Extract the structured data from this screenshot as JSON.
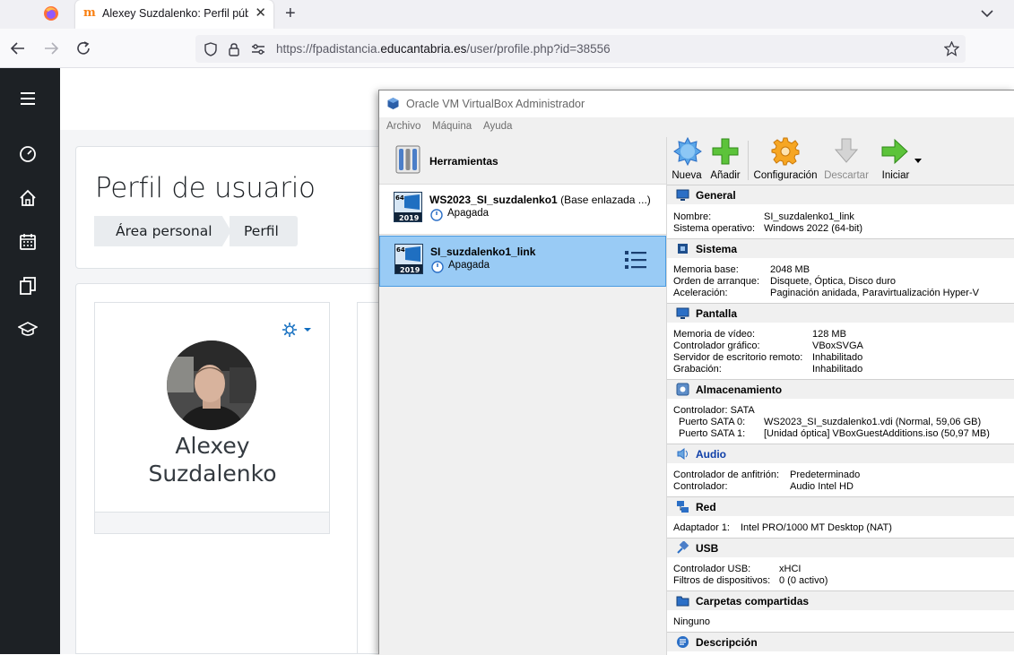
{
  "browser": {
    "tab_title": "Alexey Suzdalenko: Perfil público",
    "url_prefix": "https://fpadistancia.",
    "url_domain": "educantabria.es",
    "url_suffix": "/user/profile.php?id=38556"
  },
  "moodle": {
    "page_title": "Perfil de usuario",
    "breadcrumb": [
      "Área personal",
      "Perfil"
    ],
    "user_first": "Alexey",
    "user_last": "Suzdalenko",
    "sidebar_icons": [
      "menu-icon",
      "dashboard-icon",
      "home-icon",
      "calendar-icon",
      "files-icon",
      "courses-icon"
    ]
  },
  "vbox": {
    "title": "Oracle VM VirtualBox Administrador",
    "menu": [
      "Archivo",
      "Máquina",
      "Ayuda"
    ],
    "tools_label": "Herramientas",
    "vms": [
      {
        "name": "WS2023_SI_suzdalenko1",
        "extra": " (Base enlazada ...)",
        "state": "Apagada",
        "os_badge": "2019"
      },
      {
        "name": "SI_suzdalenko1_link",
        "extra": "",
        "state": "Apagada",
        "os_badge": "2019"
      }
    ],
    "toolbar": {
      "new": "Nueva",
      "add": "Añadir",
      "settings": "Configuración",
      "discard": "Descartar",
      "start": "Iniciar"
    },
    "sections": {
      "general": {
        "title": "General",
        "rows": [
          [
            "Nombre:",
            "SI_suzdalenko1_link"
          ],
          [
            "Sistema operativo:",
            "Windows 2022 (64-bit)"
          ]
        ]
      },
      "system": {
        "title": "Sistema",
        "rows": [
          [
            "Memoria base:",
            "2048 MB"
          ],
          [
            "Orden de arranque:",
            "Disquete, Óptica, Disco duro"
          ],
          [
            "Aceleración:",
            "Paginación anidada, Paravirtualización Hyper-V"
          ]
        ]
      },
      "display": {
        "title": "Pantalla",
        "rows": [
          [
            "Memoria de vídeo:",
            "128 MB"
          ],
          [
            "Controlador gráfico:",
            "VBoxSVGA"
          ],
          [
            "Servidor de escritorio remoto:",
            "Inhabilitado"
          ],
          [
            "Grabación:",
            "Inhabilitado"
          ]
        ]
      },
      "storage": {
        "title": "Almacenamiento",
        "controller": "Controlador: SATA",
        "rows": [
          [
            "Puerto SATA 0:",
            "WS2023_SI_suzdalenko1.vdi (Normal, 59,06 GB)"
          ],
          [
            "Puerto SATA 1:",
            "[Unidad óptica] VBoxGuestAdditions.iso (50,97 MB)"
          ]
        ]
      },
      "audio": {
        "title": "Audio",
        "rows": [
          [
            "Controlador de anfitrión:",
            "Predeterminado"
          ],
          [
            "Controlador:",
            "Audio Intel HD"
          ]
        ]
      },
      "network": {
        "title": "Red",
        "rows": [
          [
            "Adaptador 1:",
            "Intel PRO/1000 MT Desktop (NAT)"
          ]
        ]
      },
      "usb": {
        "title": "USB",
        "rows": [
          [
            "Controlador USB:",
            "xHCI"
          ],
          [
            "Filtros de dispositivos:",
            "0 (0 activo)"
          ]
        ]
      },
      "shared": {
        "title": "Carpetas compartidas",
        "value": "Ninguno"
      },
      "description": {
        "title": "Descripción"
      }
    }
  }
}
